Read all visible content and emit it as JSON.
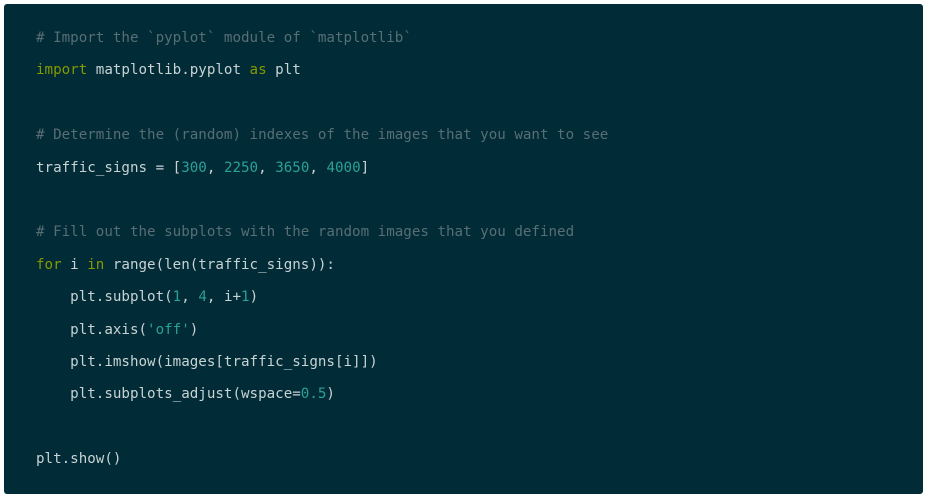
{
  "code": {
    "language": "python",
    "colors": {
      "background": "#012b36",
      "comment": "#586e75",
      "keyword": "#859900",
      "number": "#2aa198",
      "string": "#2aa198",
      "text": "#c8d3d4"
    },
    "lines": [
      {
        "tokens": [
          {
            "type": "comment",
            "text": "# Import the `pyplot` module of `matplotlib`"
          }
        ]
      },
      {
        "tokens": [
          {
            "type": "keyword",
            "text": "import"
          },
          {
            "type": "plain",
            "text": " matplotlib.pyplot "
          },
          {
            "type": "keyword",
            "text": "as"
          },
          {
            "type": "plain",
            "text": " plt"
          }
        ]
      },
      {
        "tokens": []
      },
      {
        "tokens": [
          {
            "type": "comment",
            "text": "# Determine the (random) indexes of the images that you want to see"
          }
        ]
      },
      {
        "tokens": [
          {
            "type": "plain",
            "text": "traffic_signs = ["
          },
          {
            "type": "number",
            "text": "300"
          },
          {
            "type": "plain",
            "text": ", "
          },
          {
            "type": "number",
            "text": "2250"
          },
          {
            "type": "plain",
            "text": ", "
          },
          {
            "type": "number",
            "text": "3650"
          },
          {
            "type": "plain",
            "text": ", "
          },
          {
            "type": "number",
            "text": "4000"
          },
          {
            "type": "plain",
            "text": "]"
          }
        ]
      },
      {
        "tokens": []
      },
      {
        "tokens": [
          {
            "type": "comment",
            "text": "# Fill out the subplots with the random images that you defined"
          }
        ]
      },
      {
        "tokens": [
          {
            "type": "keyword",
            "text": "for"
          },
          {
            "type": "plain",
            "text": " i "
          },
          {
            "type": "keyword",
            "text": "in"
          },
          {
            "type": "plain",
            "text": " range(len(traffic_signs)):"
          }
        ]
      },
      {
        "tokens": [
          {
            "type": "plain",
            "text": "    plt.subplot("
          },
          {
            "type": "number",
            "text": "1"
          },
          {
            "type": "plain",
            "text": ", "
          },
          {
            "type": "number",
            "text": "4"
          },
          {
            "type": "plain",
            "text": ", i+"
          },
          {
            "type": "number",
            "text": "1"
          },
          {
            "type": "plain",
            "text": ")"
          }
        ]
      },
      {
        "tokens": [
          {
            "type": "plain",
            "text": "    plt.axis("
          },
          {
            "type": "string",
            "text": "'off'"
          },
          {
            "type": "plain",
            "text": ")"
          }
        ]
      },
      {
        "tokens": [
          {
            "type": "plain",
            "text": "    plt.imshow(images[traffic_signs[i]])"
          }
        ]
      },
      {
        "tokens": [
          {
            "type": "plain",
            "text": "    plt.subplots_adjust(wspace="
          },
          {
            "type": "number",
            "text": "0.5"
          },
          {
            "type": "plain",
            "text": ")"
          }
        ]
      },
      {
        "tokens": []
      },
      {
        "tokens": [
          {
            "type": "plain",
            "text": "plt.show()"
          }
        ]
      }
    ]
  }
}
